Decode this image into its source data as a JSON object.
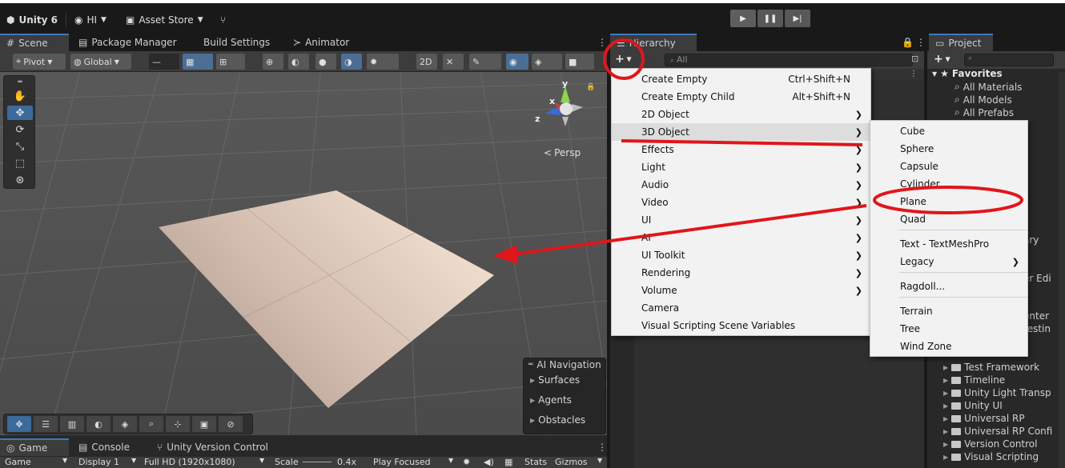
{
  "topbar": {
    "unity_label": "Unity 6",
    "account_label": "HI",
    "asset_store_label": "Asset Store",
    "play_icons": [
      "play-icon",
      "pause-icon",
      "step-icon"
    ]
  },
  "scene_tabs": [
    "Scene",
    "Package Manager",
    "Build Settings",
    "Animator"
  ],
  "scene_toolbar": {
    "pivot_label": "Pivot",
    "global_label": "Global",
    "persp_label": "Persp",
    "axis_y": "y",
    "axis_x": "x",
    "axis_z": "z"
  },
  "ai_navigation": {
    "title": "AI Navigation",
    "items": [
      "Surfaces",
      "Agents",
      "Obstacles"
    ]
  },
  "bottom_tabs": {
    "tabs": [
      "Game",
      "Console",
      "Unity Version Control"
    ],
    "game_label": "Game",
    "display_label": "Display 1",
    "resolution_label": "Full HD (1920x1080)",
    "scale_label": "Scale",
    "scale_value": "0.4x",
    "play_focused_label": "Play Focused",
    "stats_label": "Stats",
    "gizmos_label": "Gizmos"
  },
  "hierarchy": {
    "tab_label": "Hierarchy",
    "search_placeholder": "All"
  },
  "project": {
    "tab_label": "Project",
    "favorites_label": "Favorites",
    "favorites": [
      "All Materials",
      "All Models",
      "All Prefabs"
    ],
    "partial_items": [
      "ary",
      "t",
      "er Edi",
      "enter",
      "testin"
    ],
    "folders": [
      "Test Framework",
      "Timeline",
      "Unity Light Transp",
      "Unity UI",
      "Universal RP",
      "Universal RP Confi",
      "Version Control",
      "Visual Scripting"
    ]
  },
  "create_menu": [
    {
      "label": "Create Empty",
      "shortcut": "Ctrl+Shift+N",
      "submenu": false
    },
    {
      "label": "Create Empty Child",
      "shortcut": "Alt+Shift+N",
      "submenu": false
    },
    {
      "label": "2D Object",
      "shortcut": "",
      "submenu": true
    },
    {
      "label": "3D Object",
      "shortcut": "",
      "submenu": true
    },
    {
      "label": "Effects",
      "shortcut": "",
      "submenu": true
    },
    {
      "label": "Light",
      "shortcut": "",
      "submenu": true
    },
    {
      "label": "Audio",
      "shortcut": "",
      "submenu": true
    },
    {
      "label": "Video",
      "shortcut": "",
      "submenu": true
    },
    {
      "label": "UI",
      "shortcut": "",
      "submenu": true
    },
    {
      "label": "AI",
      "shortcut": "",
      "submenu": true
    },
    {
      "label": "UI Toolkit",
      "shortcut": "",
      "submenu": true
    },
    {
      "label": "Rendering",
      "shortcut": "",
      "submenu": true
    },
    {
      "label": "Volume",
      "shortcut": "",
      "submenu": true
    },
    {
      "label": "Camera",
      "shortcut": "",
      "submenu": false
    },
    {
      "label": "Visual Scripting Scene Variables",
      "shortcut": "",
      "submenu": false
    }
  ],
  "object_menu": [
    {
      "label": "Cube",
      "submenu": false
    },
    {
      "label": "Sphere",
      "submenu": false
    },
    {
      "label": "Capsule",
      "submenu": false
    },
    {
      "label": "Cylinder",
      "submenu": false
    },
    {
      "label": "Plane",
      "submenu": false
    },
    {
      "label": "Quad",
      "submenu": false
    },
    {
      "label": "Text - TextMeshPro",
      "submenu": false
    },
    {
      "label": "Legacy",
      "submenu": true
    },
    {
      "label": "Ragdoll...",
      "submenu": false
    },
    {
      "label": "Terrain",
      "submenu": false
    },
    {
      "label": "Tree",
      "submenu": false
    },
    {
      "label": "Wind Zone",
      "submenu": false
    }
  ],
  "colors": {
    "annotation_red": "#e0161b",
    "plane_light": "#e6d2c4",
    "plane_dark": "#bca598",
    "accent_blue": "#3a79bb"
  }
}
